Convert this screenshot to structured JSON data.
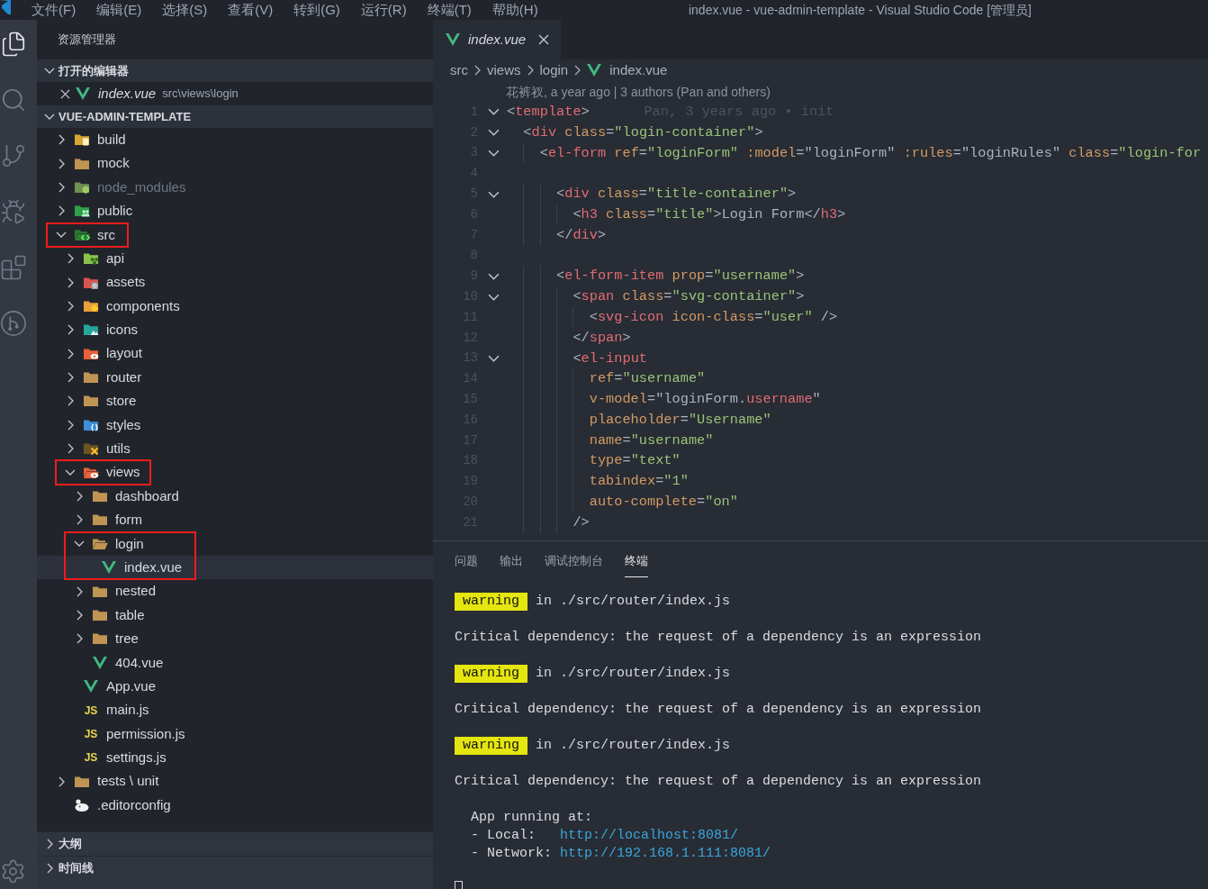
{
  "title_bar": {
    "menus": [
      "文件(F)",
      "编辑(E)",
      "选择(S)",
      "查看(V)",
      "转到(G)",
      "运行(R)",
      "终端(T)",
      "帮助(H)"
    ],
    "title": "index.vue - vue-admin-template - Visual Studio Code [管理员]"
  },
  "activity_bar": {
    "items": [
      {
        "kind": "explorer",
        "selected": true
      },
      {
        "kind": "search",
        "selected": false
      },
      {
        "kind": "source-control",
        "selected": false
      },
      {
        "kind": "run",
        "selected": false
      },
      {
        "kind": "extensions",
        "selected": false
      },
      {
        "kind": "git-graph",
        "selected": false
      }
    ]
  },
  "sidebar": {
    "title": "资源管理器",
    "open_editors": {
      "label": "打开的编辑器",
      "expanded": true,
      "items": [
        {
          "kind": "vue",
          "name": "index.vue",
          "path": "src\\views\\login",
          "preview": true,
          "selected": false
        }
      ]
    },
    "workspace": {
      "label": "VUE-ADMIN-TEMPLATE",
      "expanded": true,
      "tree": [
        {
          "kind": "build",
          "name": "build",
          "expanded": false,
          "selected": false,
          "dimmed": false,
          "annotated": false
        },
        {
          "kind": "folder",
          "name": "mock",
          "expanded": false,
          "selected": false,
          "dimmed": false,
          "annotated": false
        },
        {
          "kind": "node",
          "name": "node_modules",
          "expanded": false,
          "selected": false,
          "dimmed": true,
          "annotated": false
        },
        {
          "kind": "public",
          "name": "public",
          "expanded": false,
          "selected": false,
          "dimmed": false,
          "annotated": false
        },
        {
          "kind": "src",
          "name": "src",
          "expanded": true,
          "selected": false,
          "dimmed": false,
          "annotated": true,
          "children": [
            {
              "kind": "api",
              "name": "api",
              "expanded": false,
              "selected": false,
              "dimmed": false,
              "annotated": false
            },
            {
              "kind": "assets",
              "name": "assets",
              "expanded": false,
              "selected": false,
              "dimmed": false,
              "annotated": false
            },
            {
              "kind": "components",
              "name": "components",
              "expanded": false,
              "selected": false,
              "dimmed": false,
              "annotated": false
            },
            {
              "kind": "icons",
              "name": "icons",
              "expanded": false,
              "selected": false,
              "dimmed": false,
              "annotated": false
            },
            {
              "kind": "layout",
              "name": "layout",
              "expanded": false,
              "selected": false,
              "dimmed": false,
              "annotated": false
            },
            {
              "kind": "folder",
              "name": "router",
              "expanded": false,
              "selected": false,
              "dimmed": false,
              "annotated": false
            },
            {
              "kind": "folder",
              "name": "store",
              "expanded": false,
              "selected": false,
              "dimmed": false,
              "annotated": false
            },
            {
              "kind": "styles",
              "name": "styles",
              "expanded": false,
              "selected": false,
              "dimmed": false,
              "annotated": false
            },
            {
              "kind": "utils",
              "name": "utils",
              "expanded": false,
              "selected": false,
              "dimmed": false,
              "annotated": false
            },
            {
              "kind": "views",
              "name": "views",
              "expanded": true,
              "selected": false,
              "dimmed": false,
              "annotated": true,
              "children": [
                {
                  "kind": "folder",
                  "name": "dashboard",
                  "expanded": false,
                  "selected": false,
                  "dimmed": false,
                  "annotated": false
                },
                {
                  "kind": "folder",
                  "name": "form",
                  "expanded": false,
                  "selected": false,
                  "dimmed": false,
                  "annotated": false
                },
                {
                  "kind": "folder",
                  "name": "login",
                  "expanded": true,
                  "selected": false,
                  "dimmed": false,
                  "annotated": true,
                  "children": [
                    {
                      "kind": "vue",
                      "name": "index.vue",
                      "selected": true,
                      "dimmed": false,
                      "annotated": true
                    }
                  ]
                },
                {
                  "kind": "folder",
                  "name": "nested",
                  "expanded": false,
                  "selected": false,
                  "dimmed": false,
                  "annotated": false
                },
                {
                  "kind": "folder",
                  "name": "table",
                  "expanded": false,
                  "selected": false,
                  "dimmed": false,
                  "annotated": false
                },
                {
                  "kind": "folder",
                  "name": "tree",
                  "expanded": false,
                  "selected": false,
                  "dimmed": false,
                  "annotated": false
                },
                {
                  "kind": "vue",
                  "name": "404.vue",
                  "selected": false,
                  "dimmed": false,
                  "annotated": false
                }
              ]
            },
            {
              "kind": "vue",
              "name": "App.vue",
              "selected": false,
              "dimmed": false,
              "annotated": false
            },
            {
              "kind": "js",
              "name": "main.js",
              "icon_label": "JS",
              "selected": false,
              "dimmed": false,
              "annotated": false
            },
            {
              "kind": "js",
              "name": "permission.js",
              "icon_label": "JS",
              "selected": false,
              "dimmed": false,
              "annotated": false
            },
            {
              "kind": "js",
              "name": "settings.js",
              "icon_label": "JS",
              "selected": false,
              "dimmed": false,
              "annotated": false
            }
          ]
        },
        {
          "kind": "folder",
          "name": "tests \\ unit",
          "expanded": false,
          "selected": false,
          "dimmed": false,
          "annotated": false
        },
        {
          "kind": "config",
          "name": ".editorconfig",
          "selected": false,
          "dimmed": false,
          "annotated": false
        }
      ]
    },
    "panes": [
      {
        "label": "大纲",
        "expanded": false
      },
      {
        "label": "时间线",
        "expanded": false
      }
    ]
  },
  "editor": {
    "tabs": [
      {
        "kind": "vue",
        "name": "index.vue",
        "preview": true,
        "selected": true
      }
    ],
    "breadcrumb": [
      {
        "kind": "folder",
        "label": "src"
      },
      {
        "kind": "folder",
        "label": "views"
      },
      {
        "kind": "folder",
        "label": "login"
      },
      {
        "kind": "vue",
        "label": "index.vue"
      }
    ],
    "codelens": "花裤衩, a year ago | 3 authors (Pan and others)",
    "lines": [
      {
        "number": "1",
        "foldable": true,
        "blame": "Pan, 3 years ago • init",
        "tokens": [
          {
            "kind": "punct",
            "text": "<"
          },
          {
            "kind": "tag",
            "text": "template"
          },
          {
            "kind": "punct",
            "text": ">"
          }
        ]
      },
      {
        "number": "2",
        "foldable": true,
        "tokens": [
          {
            "kind": "punct",
            "text": "  <"
          },
          {
            "kind": "tag",
            "text": "div"
          },
          {
            "kind": "attr",
            "text": " class"
          },
          {
            "kind": "punct",
            "text": "="
          },
          {
            "kind": "string",
            "text": "\"login-container\""
          },
          {
            "kind": "punct",
            "text": ">"
          }
        ]
      },
      {
        "number": "3",
        "foldable": true,
        "tokens": [
          {
            "kind": "punct",
            "text": "    <"
          },
          {
            "kind": "tag",
            "text": "el-form"
          },
          {
            "kind": "attr",
            "text": " ref"
          },
          {
            "kind": "punct",
            "text": "="
          },
          {
            "kind": "string",
            "text": "\"loginForm\""
          },
          {
            "kind": "attr",
            "text": " :model"
          },
          {
            "kind": "punct",
            "text": "="
          },
          {
            "kind": "text",
            "text": "\"loginForm\""
          },
          {
            "kind": "attr",
            "text": " :rules"
          },
          {
            "kind": "punct",
            "text": "="
          },
          {
            "kind": "text",
            "text": "\"loginRules\""
          },
          {
            "kind": "attr",
            "text": " class"
          },
          {
            "kind": "punct",
            "text": "="
          },
          {
            "kind": "string",
            "text": "\"login-for"
          }
        ]
      },
      {
        "number": "4",
        "foldable": false
      },
      {
        "number": "5",
        "foldable": true,
        "tokens": [
          {
            "kind": "punct",
            "text": "      <"
          },
          {
            "kind": "tag",
            "text": "div"
          },
          {
            "kind": "attr",
            "text": " class"
          },
          {
            "kind": "punct",
            "text": "="
          },
          {
            "kind": "string",
            "text": "\"title-container\""
          },
          {
            "kind": "punct",
            "text": ">"
          }
        ]
      },
      {
        "number": "6",
        "foldable": false,
        "tokens": [
          {
            "kind": "punct",
            "text": "        <"
          },
          {
            "kind": "tag",
            "text": "h3"
          },
          {
            "kind": "attr",
            "text": " class"
          },
          {
            "kind": "punct",
            "text": "="
          },
          {
            "kind": "string",
            "text": "\"title\""
          },
          {
            "kind": "punct",
            "text": ">"
          },
          {
            "kind": "text",
            "text": "Login Form"
          },
          {
            "kind": "punct",
            "text": "</"
          },
          {
            "kind": "tag",
            "text": "h3"
          },
          {
            "kind": "punct",
            "text": ">"
          }
        ]
      },
      {
        "number": "7",
        "foldable": false,
        "tokens": [
          {
            "kind": "punct",
            "text": "      </"
          },
          {
            "kind": "tag",
            "text": "div"
          },
          {
            "kind": "punct",
            "text": ">"
          }
        ]
      },
      {
        "number": "8",
        "foldable": false
      },
      {
        "number": "9",
        "foldable": true,
        "tokens": [
          {
            "kind": "punct",
            "text": "      <"
          },
          {
            "kind": "tag",
            "text": "el-form-item"
          },
          {
            "kind": "attr",
            "text": " prop"
          },
          {
            "kind": "punct",
            "text": "="
          },
          {
            "kind": "string",
            "text": "\"username\""
          },
          {
            "kind": "punct",
            "text": ">"
          }
        ]
      },
      {
        "number": "10",
        "foldable": true,
        "tokens": [
          {
            "kind": "punct",
            "text": "        <"
          },
          {
            "kind": "tag",
            "text": "span"
          },
          {
            "kind": "attr",
            "text": " class"
          },
          {
            "kind": "punct",
            "text": "="
          },
          {
            "kind": "string",
            "text": "\"svg-container\""
          },
          {
            "kind": "punct",
            "text": ">"
          }
        ]
      },
      {
        "number": "11",
        "foldable": false,
        "tokens": [
          {
            "kind": "punct",
            "text": "          <"
          },
          {
            "kind": "tag",
            "text": "svg-icon"
          },
          {
            "kind": "attr",
            "text": " icon-class"
          },
          {
            "kind": "punct",
            "text": "="
          },
          {
            "kind": "string",
            "text": "\"user\""
          },
          {
            "kind": "punct",
            "text": " />"
          }
        ]
      },
      {
        "number": "12",
        "foldable": false,
        "tokens": [
          {
            "kind": "punct",
            "text": "        </"
          },
          {
            "kind": "tag",
            "text": "span"
          },
          {
            "kind": "punct",
            "text": ">"
          }
        ]
      },
      {
        "number": "13",
        "foldable": true,
        "tokens": [
          {
            "kind": "punct",
            "text": "        <"
          },
          {
            "kind": "tag",
            "text": "el-input"
          }
        ]
      },
      {
        "number": "14",
        "foldable": false,
        "tokens": [
          {
            "kind": "attr",
            "text": "          ref"
          },
          {
            "kind": "punct",
            "text": "="
          },
          {
            "kind": "string",
            "text": "\"username\""
          }
        ]
      },
      {
        "number": "15",
        "foldable": false,
        "tokens": [
          {
            "kind": "attr",
            "text": "          v-model"
          },
          {
            "kind": "punct",
            "text": "="
          },
          {
            "kind": "text",
            "text": "\"loginForm."
          },
          {
            "kind": "var",
            "text": "username"
          },
          {
            "kind": "text",
            "text": "\""
          }
        ]
      },
      {
        "number": "16",
        "foldable": false,
        "tokens": [
          {
            "kind": "attr",
            "text": "          placeholder"
          },
          {
            "kind": "punct",
            "text": "="
          },
          {
            "kind": "string",
            "text": "\"Username\""
          }
        ]
      },
      {
        "number": "17",
        "foldable": false,
        "tokens": [
          {
            "kind": "attr",
            "text": "          name"
          },
          {
            "kind": "punct",
            "text": "="
          },
          {
            "kind": "string",
            "text": "\"username\""
          }
        ]
      },
      {
        "number": "18",
        "foldable": false,
        "tokens": [
          {
            "kind": "attr",
            "text": "          type"
          },
          {
            "kind": "punct",
            "text": "="
          },
          {
            "kind": "string",
            "text": "\"text\""
          }
        ]
      },
      {
        "number": "19",
        "foldable": false,
        "tokens": [
          {
            "kind": "attr",
            "text": "          tabindex"
          },
          {
            "kind": "punct",
            "text": "="
          },
          {
            "kind": "string",
            "text": "\"1\""
          }
        ]
      },
      {
        "number": "20",
        "foldable": false,
        "tokens": [
          {
            "kind": "attr",
            "text": "          auto-complete"
          },
          {
            "kind": "punct",
            "text": "="
          },
          {
            "kind": "string",
            "text": "\"on\""
          }
        ]
      },
      {
        "number": "21",
        "foldable": false,
        "tokens": [
          {
            "kind": "punct",
            "text": "        />"
          }
        ]
      }
    ]
  },
  "panel": {
    "tabs": [
      {
        "label": "问题",
        "selected": false
      },
      {
        "label": "输出",
        "selected": false
      },
      {
        "label": "调试控制台",
        "selected": false
      },
      {
        "label": "终端",
        "selected": true
      }
    ],
    "terminal": [
      {
        "kind": "warning",
        "badge": "warning",
        "text": "in ./src/router/index.js"
      },
      {
        "kind": "message",
        "text": "Critical dependency: the request of a dependency is an expression"
      },
      {
        "kind": "warning",
        "badge": "warning",
        "text": "in ./src/router/index.js"
      },
      {
        "kind": "message",
        "text": "Critical dependency: the request of a dependency is an expression"
      },
      {
        "kind": "warning",
        "badge": "warning",
        "text": "in ./src/router/index.js"
      },
      {
        "kind": "message",
        "text": "Critical dependency: the request of a dependency is an expression"
      },
      {
        "kind": "plain",
        "text": "App running at:"
      },
      {
        "kind": "link",
        "label": "- Local:",
        "url": "http://localhost:8081/"
      },
      {
        "kind": "link",
        "label": "- Network:",
        "url": "http://192.168.1.111:8081/"
      },
      {
        "kind": "cursor"
      }
    ]
  }
}
